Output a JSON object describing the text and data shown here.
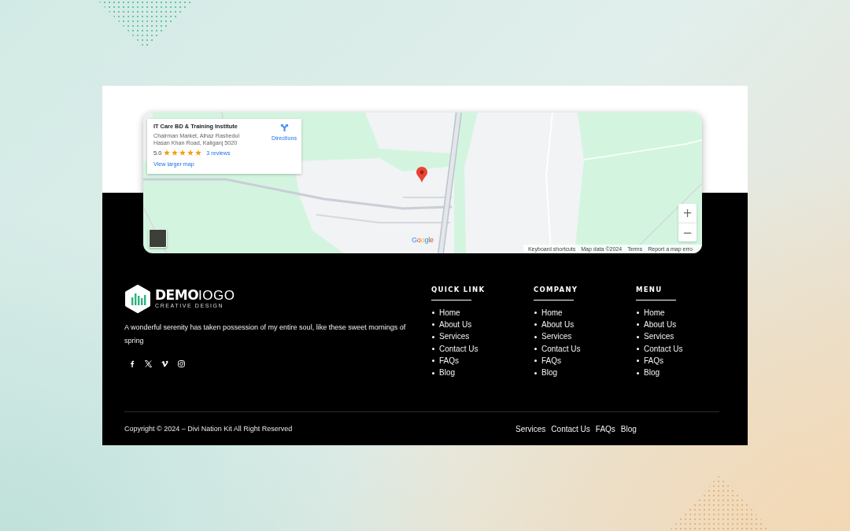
{
  "map": {
    "place_card": {
      "title": "IT Care BD & Training Institute",
      "address_lines": [
        "Chairman Market, Alhaz Rashedul",
        "Hasan Khan Road, Kaliganj 5020"
      ],
      "rating": "5.0",
      "stars": 5,
      "reviews": "3 reviews",
      "larger_map_link": "View larger map",
      "directions": "Directions"
    },
    "zoom_in": "+",
    "zoom_out": "−",
    "logo": "Google",
    "attribution": [
      "Keyboard shortcuts",
      "Map data ©2024",
      "Terms",
      "Report a map erro"
    ]
  },
  "footer": {
    "logo": {
      "bold": "DEMO",
      "light": "IOGO",
      "tagline": "CREATIVE DESIGN"
    },
    "description": "A wonderful serenity has taken possession of my entire soul, like these sweet mornings of spring",
    "columns": [
      {
        "heading": "QUICK LINK",
        "links": [
          "Home",
          "About Us",
          "Services",
          "Contact Us",
          "FAQs",
          "Blog"
        ]
      },
      {
        "heading": "COMPANY",
        "links": [
          "Home",
          "About Us",
          "Services",
          "Contact Us",
          "FAQs",
          "Blog"
        ]
      },
      {
        "heading": "MENU",
        "links": [
          "Home",
          "About Us",
          "Services",
          "Contact Us",
          "FAQs",
          "Blog"
        ]
      }
    ],
    "copyright": "Copyright © 2024 – Divi Nation Kit All Right Reserved",
    "bottom_links": [
      "Services",
      "Contact Us",
      "FAQs",
      "Blog"
    ]
  }
}
